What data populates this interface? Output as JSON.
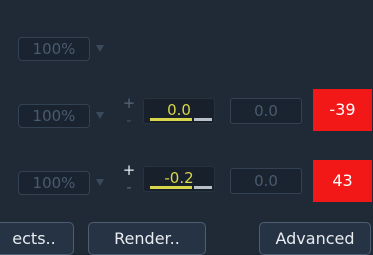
{
  "rows": [
    {
      "percent": "100%"
    },
    {
      "percent": "100%",
      "stepper_plus": "+",
      "stepper_minus": "-",
      "value": "0.0",
      "field2": "0.0",
      "badge": "-39"
    },
    {
      "percent": "100%",
      "stepper_plus": "+",
      "stepper_minus": "-",
      "value": "-0.2",
      "field2": "0.0",
      "badge": "43"
    }
  ],
  "buttons": {
    "effects": "ects..",
    "render": "Render..",
    "advanced": "Advanced"
  },
  "colors": {
    "background": "#1f2a36",
    "badge": "#f21818",
    "value_text": "#d8d64a"
  },
  "icons": [
    "dropdown-icon",
    "plus-icon",
    "minus-icon"
  ]
}
